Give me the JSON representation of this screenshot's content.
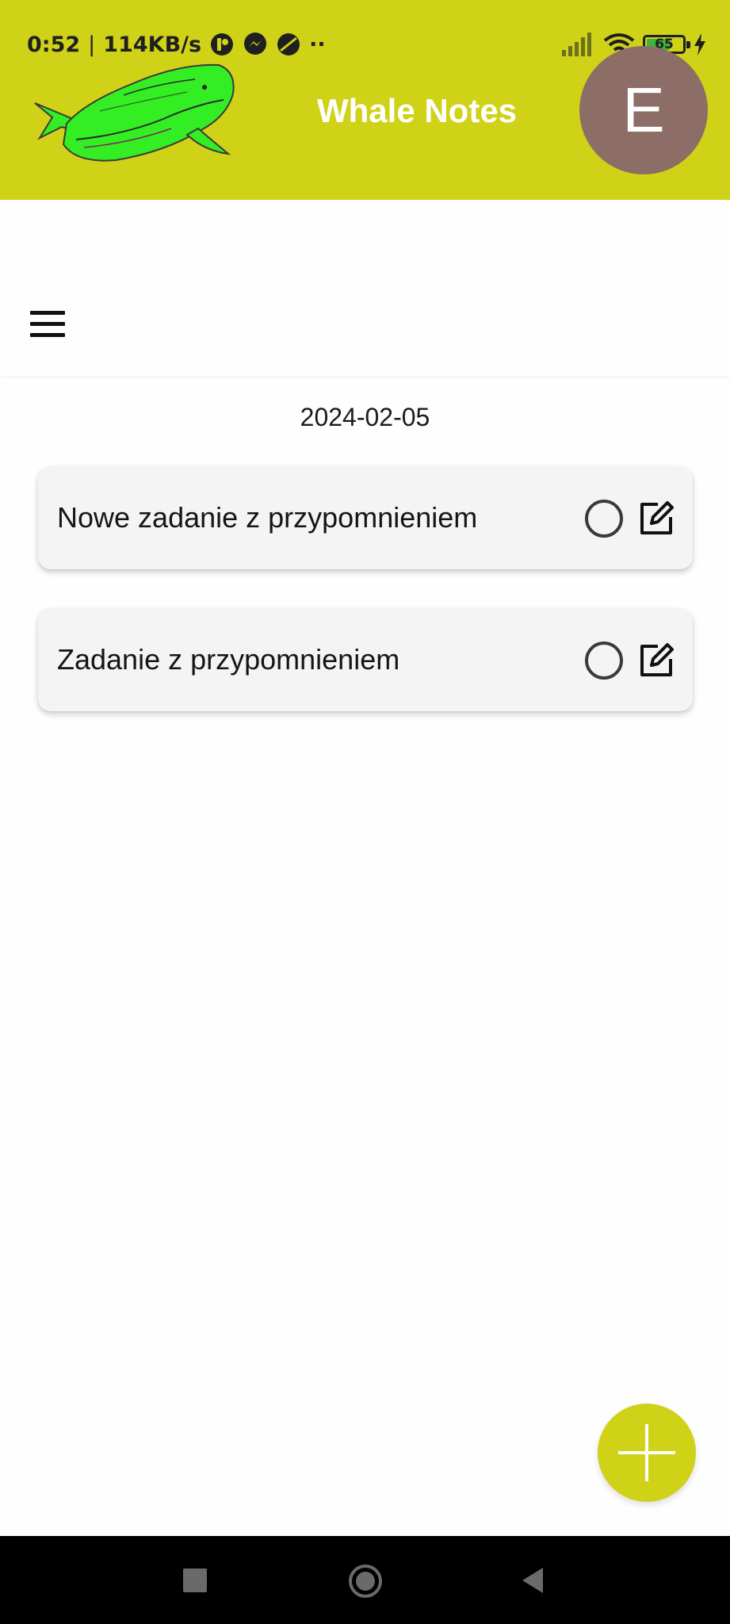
{
  "status_bar": {
    "time": "0:52",
    "separator": "|",
    "network_speed": "114KB/s",
    "notification_icons": [
      "app-notification-icon",
      "messenger-icon",
      "browser-icon"
    ],
    "overflow": "··",
    "battery_level": "65",
    "battery_fraction": 0.65,
    "signal_icon": "signal-icon",
    "wifi_icon": "wifi-icon",
    "charging_icon": "charging-bolt-icon"
  },
  "header": {
    "title": "Whale Notes",
    "avatar_initial": "E",
    "logo_icon": "whale-logo",
    "background_color": "#cfd217",
    "avatar_color": "#8c6e66"
  },
  "toolbar": {
    "menu_icon": "hamburger-menu-icon"
  },
  "main": {
    "date": "2024-02-05",
    "tasks": [
      {
        "title": "Nowe zadanie z przypomnieniem",
        "done": false
      },
      {
        "title": "Zadanie z przypomnieniem",
        "done": false
      }
    ]
  },
  "fab": {
    "icon": "plus-icon"
  },
  "nav": {
    "recents_icon": "recents-square-icon",
    "home_icon": "home-circle-icon",
    "back_icon": "back-triangle-icon"
  }
}
